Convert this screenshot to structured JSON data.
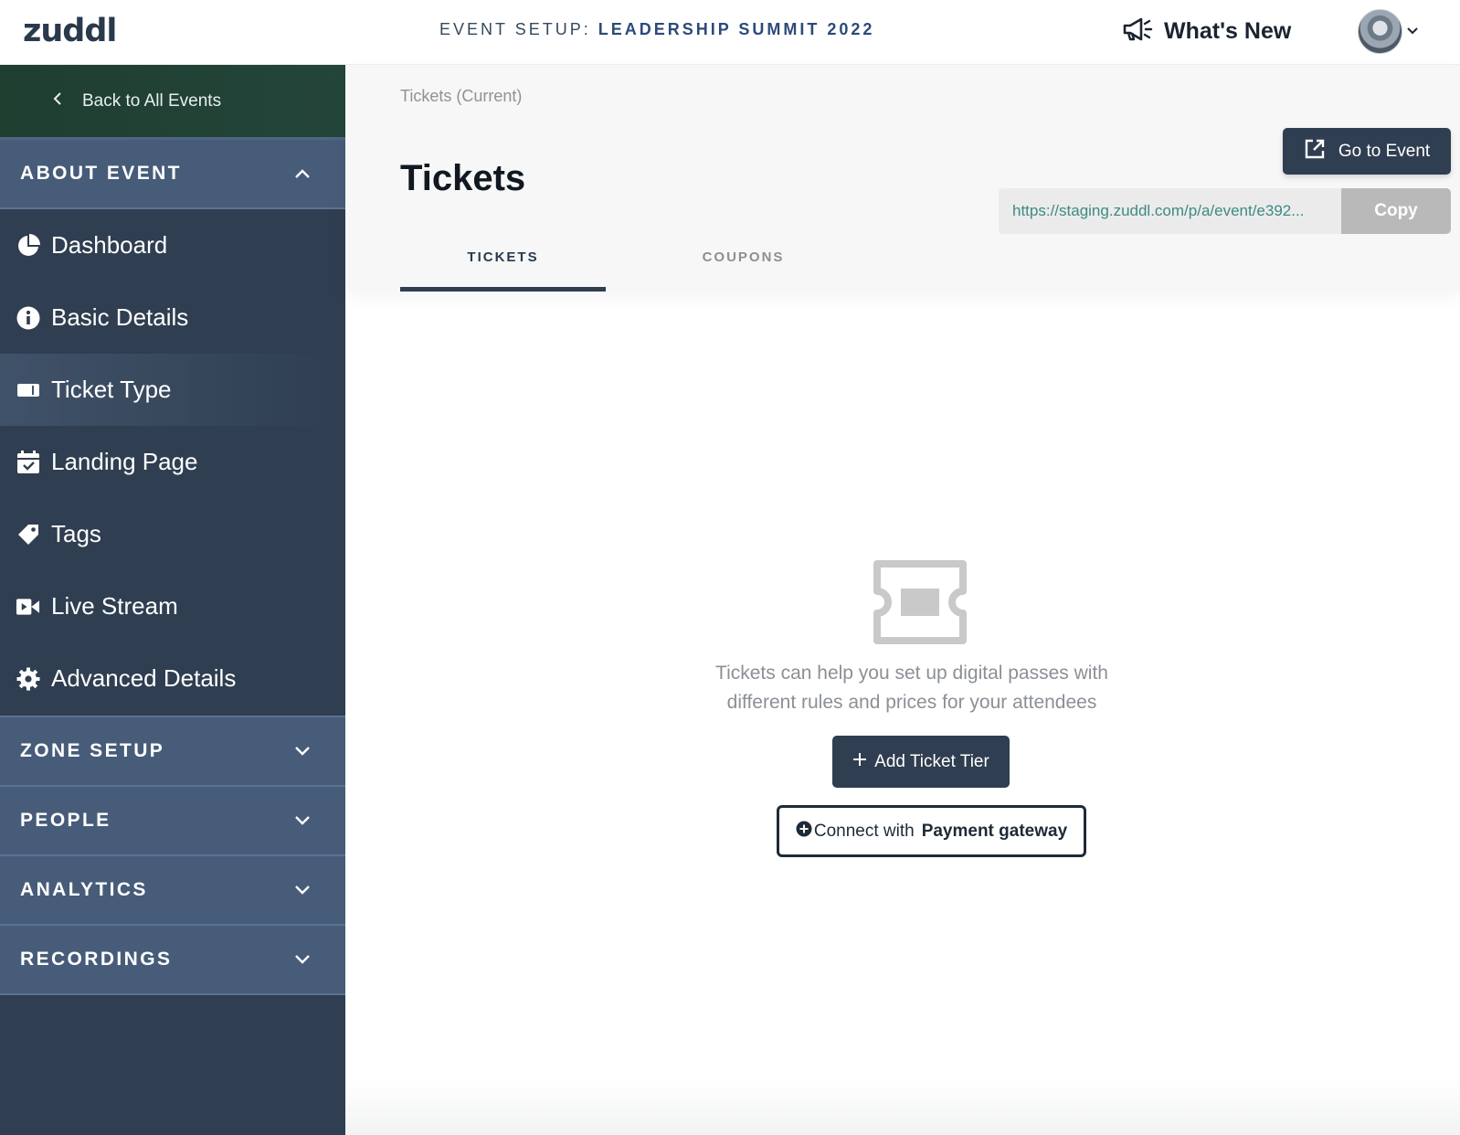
{
  "header": {
    "logo": "zuddl",
    "event_prefix": "EVENT SETUP: ",
    "event_name": "LEADERSHIP SUMMIT 2022",
    "whats_new": "What's New",
    "icons": {
      "announce": "megaphone-icon",
      "avatar_caret": "chevron-down-icon"
    }
  },
  "sidebar": {
    "back_label": "Back to All Events",
    "about_section": "ABOUT EVENT",
    "items": [
      {
        "label": "Dashboard",
        "icon": "pie-chart-icon"
      },
      {
        "label": "Basic Details",
        "icon": "info-icon"
      },
      {
        "label": "Ticket Type",
        "icon": "ticket-icon"
      },
      {
        "label": "Landing Page",
        "icon": "calendar-check-icon"
      },
      {
        "label": "Tags",
        "icon": "tag-icon"
      },
      {
        "label": "Live Stream",
        "icon": "video-icon"
      },
      {
        "label": "Advanced Details",
        "icon": "gear-icon"
      }
    ],
    "active_item": "Ticket Type",
    "sections": [
      {
        "label": "ZONE SETUP"
      },
      {
        "label": "PEOPLE"
      },
      {
        "label": "ANALYTICS"
      },
      {
        "label": "RECORDINGS"
      }
    ]
  },
  "main": {
    "breadcrumb": "Tickets (Current)",
    "title": "Tickets",
    "go_to_event": "Go to Event",
    "event_url": "https://staging.zuddl.com/p/a/event/e392...",
    "copy_label": "Copy",
    "tabs": [
      {
        "label": "TICKETS",
        "active": true
      },
      {
        "label": "COUPONS",
        "active": false
      }
    ],
    "empty_state": {
      "line1": "Tickets can help you set up digital passes with",
      "line2": "different rules and prices for your attendees",
      "add_button": "Add Ticket Tier",
      "connect_prefix": "Connect with",
      "connect_bold": "Payment gateway"
    }
  },
  "colors": {
    "sidebar_bg": "#2f3e50",
    "section_bg": "#465c79",
    "back_bg": "#1e3e30",
    "primary_button": "#2f3e50",
    "url_text": "#3e8a85",
    "copy_bg": "#b9b9b9"
  }
}
